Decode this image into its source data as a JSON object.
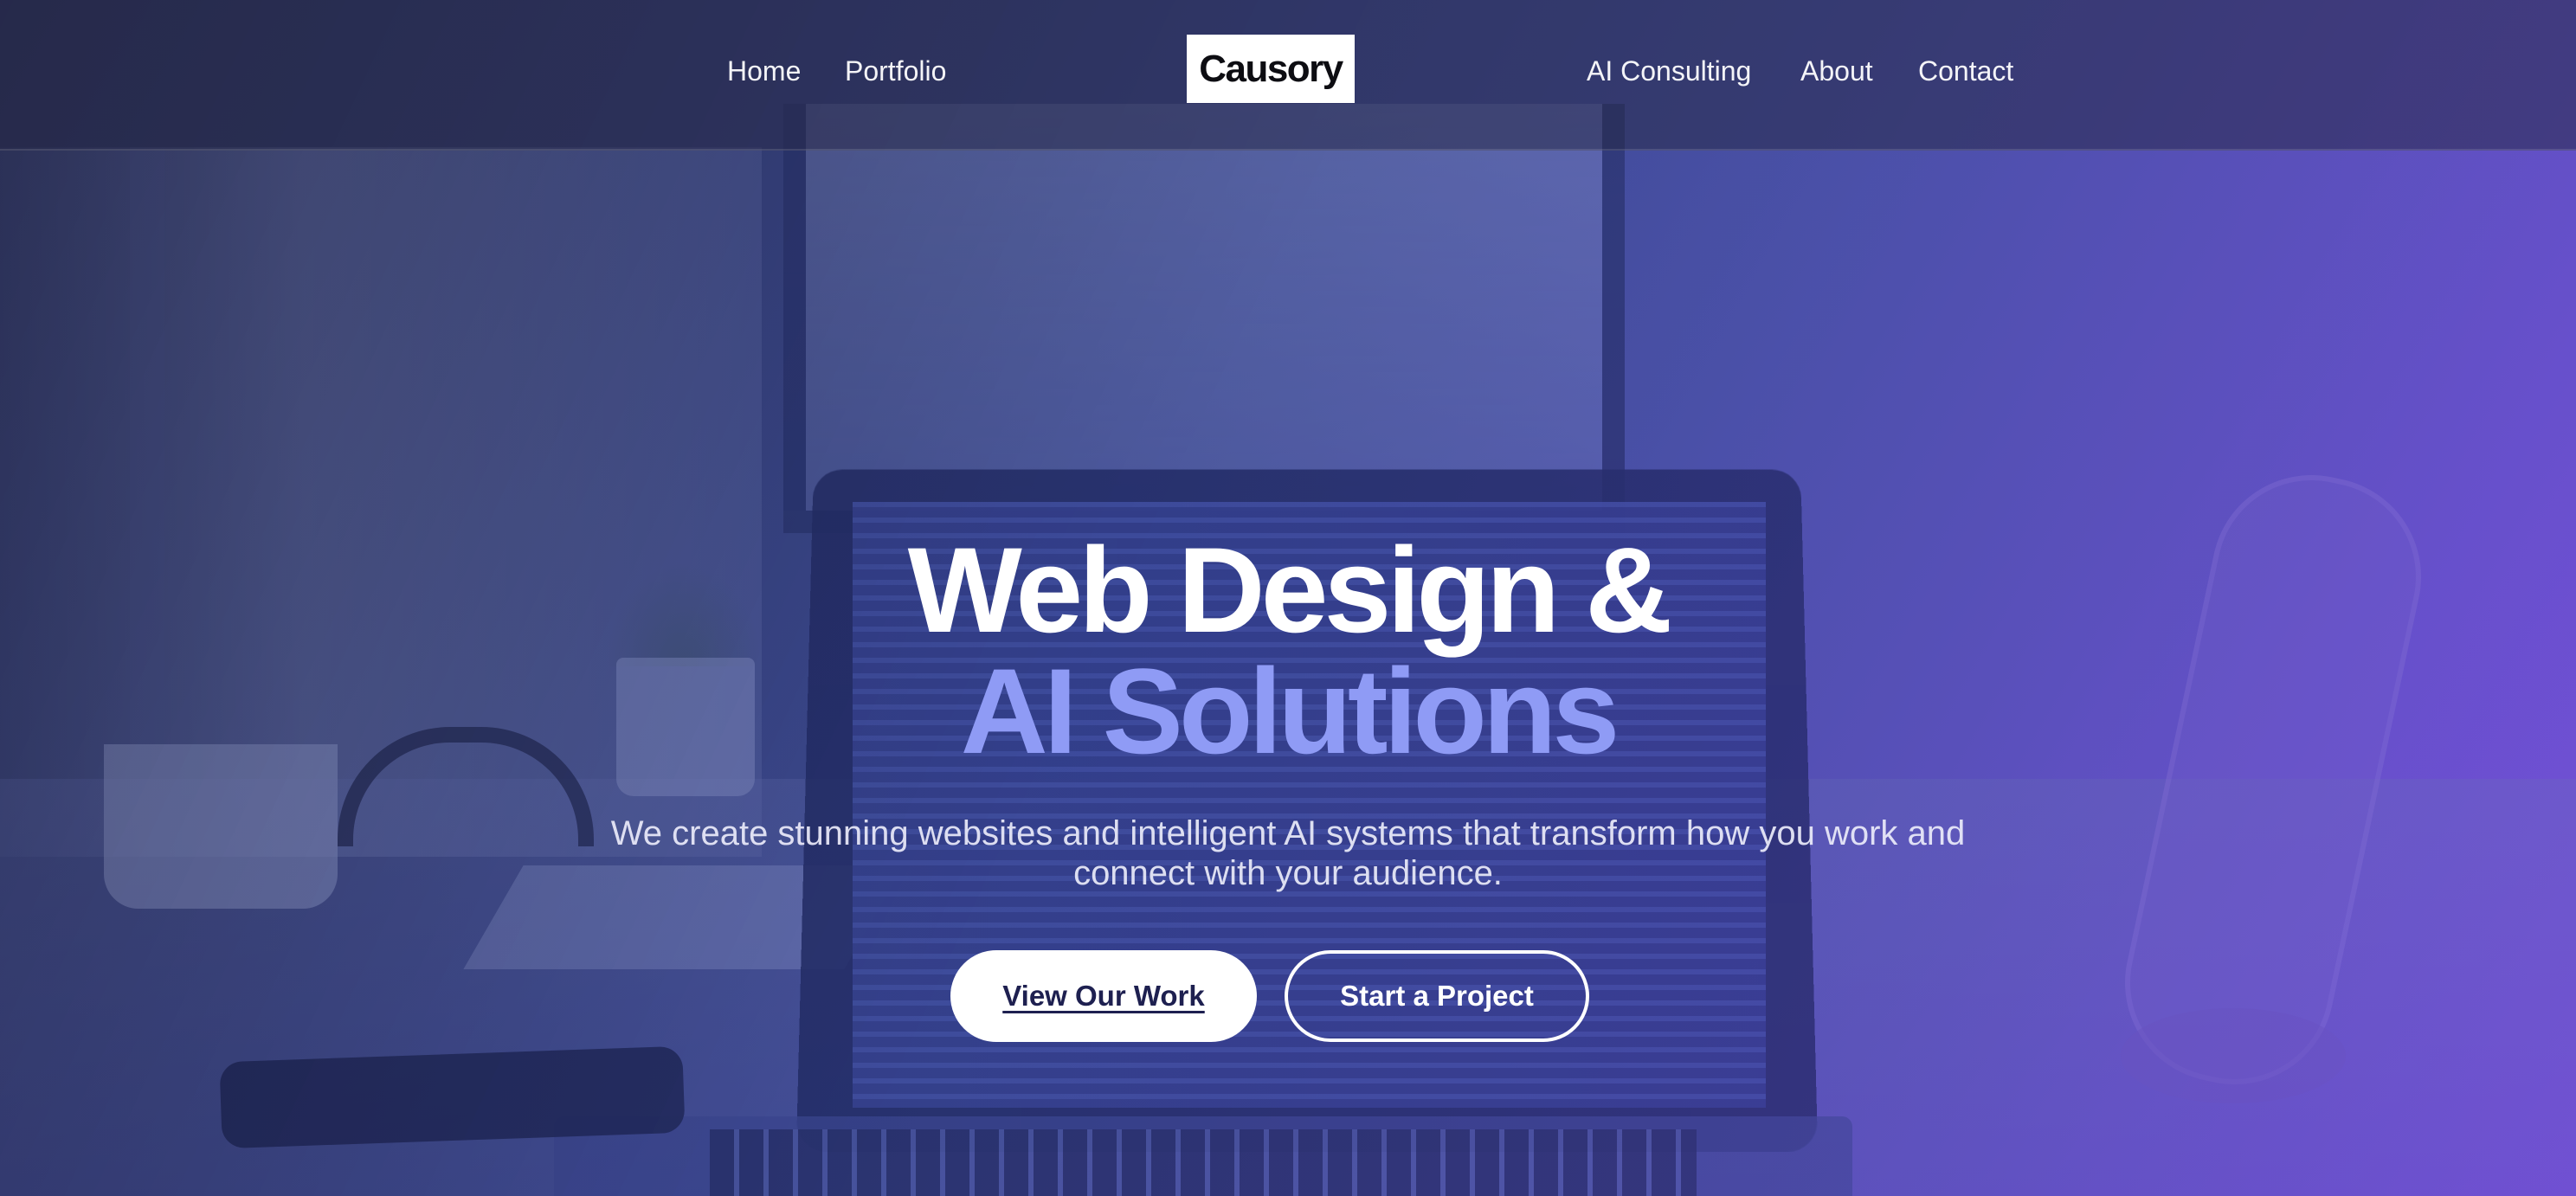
{
  "nav": {
    "left_links": [
      {
        "label": "Home"
      },
      {
        "label": "Portfolio"
      }
    ],
    "logo_text": "Causory",
    "right_links": [
      {
        "label": "AI Consulting"
      },
      {
        "label": "About"
      },
      {
        "label": "Contact"
      }
    ]
  },
  "hero": {
    "title_line_1": "Web Design &",
    "title_line_2": "AI Solutions",
    "subtitle": "We create stunning websites and intelligent AI systems that transform how you work and connect with your audience.",
    "primary_button": "View Our Work",
    "secondary_button": "Start a Project"
  },
  "colors": {
    "accent_title": "#8f9bf5",
    "gradient_start": "#2f3558",
    "gradient_end": "#7a4ed9",
    "logo_background": "#ffffff"
  }
}
